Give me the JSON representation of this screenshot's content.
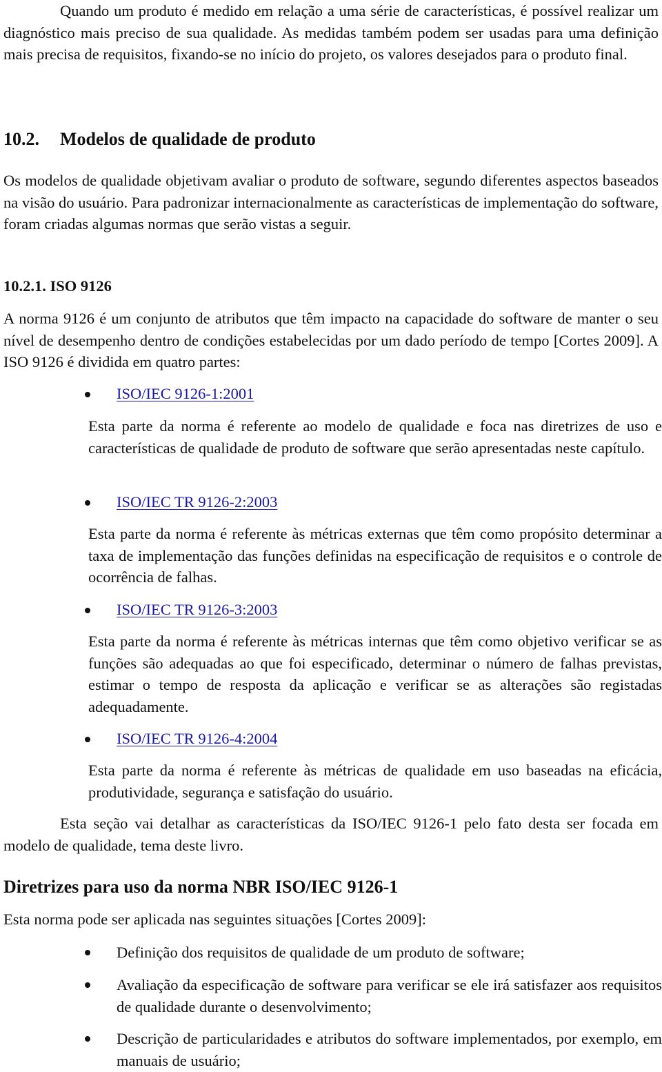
{
  "intro_paragraph": "Quando um produto é medido em relação a uma série de características, é possível realizar um diagnóstico mais preciso de sua qualidade. As medidas também podem ser usadas para uma definição mais precisa de requisitos, fixando-se no início do projeto, os valores desejados para o produto final.",
  "section_10_2": {
    "number": "10.2.",
    "title": "Modelos de qualidade de produto",
    "paragraph": "Os modelos de qualidade objetivam avaliar o produto de software, segundo diferentes aspectos baseados na visão do usuário. Para padronizar internacionalmente as características de implementação do software, foram criadas algumas normas que serão vistas a seguir."
  },
  "section_10_2_1": {
    "heading": "10.2.1. ISO 9126",
    "paragraph": "A norma 9126 é um conjunto de atributos que têm impacto na capacidade do software de manter o seu nível de desempenho dentro de condições estabelecidas por um dado período de tempo [Cortes 2009]. A ISO 9126 é dividida em quatro partes:",
    "parts": [
      {
        "link": "ISO/IEC 9126-1:2001",
        "description": "Esta parte da norma é referente ao modelo de qualidade e foca nas diretrizes de uso e características de qualidade de produto de software que serão apresentadas neste capítulo."
      },
      {
        "link": "ISO/IEC TR 9126-2:2003",
        "description": "Esta parte da norma é referente às métricas externas que têm como propósito determinar a taxa de implementação das funções definidas na especificação de requisitos e o controle de ocorrência de falhas."
      },
      {
        "link": "ISO/IEC TR 9126-3:2003",
        "description": "Esta parte da norma é referente às métricas internas que têm como objetivo verificar se as funções são adequadas ao que foi especificado, determinar o número de falhas previstas, estimar o tempo de resposta da aplicação e verificar se as alterações são registadas adequadamente."
      },
      {
        "link": "ISO/IEC TR 9126-4:2004",
        "description": "Esta parte da norma é referente às métricas de qualidade em uso baseadas na eficácia, produtividade, segurança e satisfação do usuário."
      }
    ],
    "closing_paragraph": "Esta seção vai detalhar as características da ISO/IEC 9126-1 pelo fato desta ser focada em modelo de qualidade, tema deste livro."
  },
  "guidelines": {
    "title": "Diretrizes para uso da norma NBR ISO/IEC 9126-1",
    "intro": "Esta norma pode ser aplicada nas seguintes situações [Cortes 2009]:",
    "situations": [
      "Definição dos requisitos de qualidade de um produto de software;",
      "Avaliação da especificação de software para verificar se ele irá satisfazer aos requisitos de qualidade durante o desenvolvimento;",
      "Descrição de particularidades e atributos do software implementados, por exemplo, em manuais de usuário;"
    ]
  },
  "colors": {
    "text": "#111111",
    "link": "#1a1aa6",
    "background": "#ffffff"
  }
}
